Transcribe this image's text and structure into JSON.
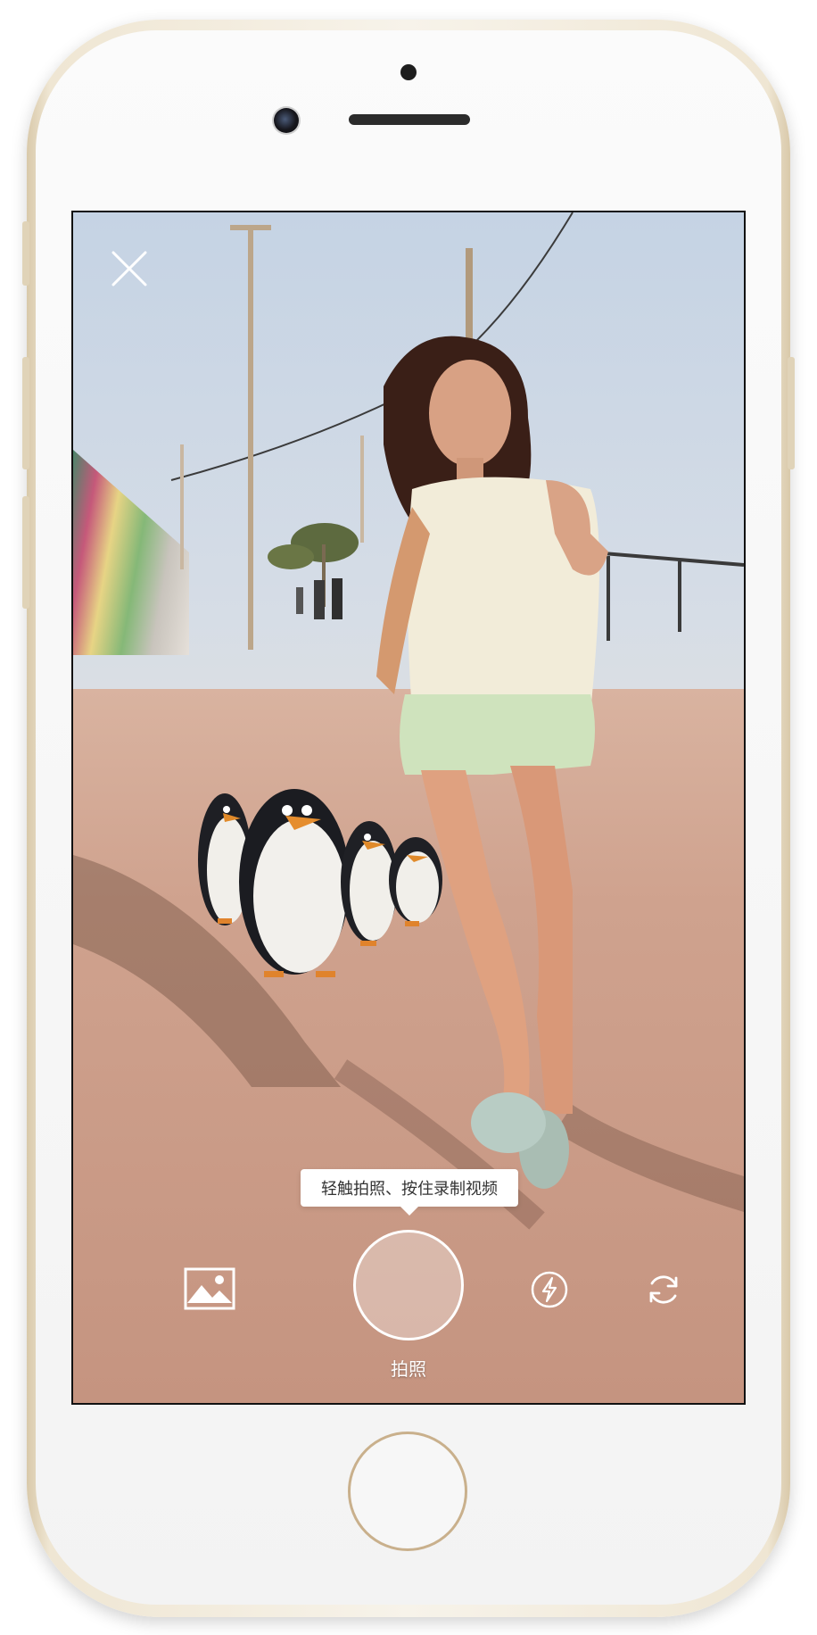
{
  "camera": {
    "tooltip": "轻触拍照、按住录制视频",
    "shutter_label": "拍照"
  },
  "icons": {
    "close": "close-icon",
    "gallery": "image-gallery-icon",
    "flash": "flash-icon",
    "switch_camera": "switch-camera-icon"
  },
  "colors": {
    "controls": "#ffffff",
    "phone_frame": "#efe6d3",
    "home_ring": "#c9b08c"
  }
}
